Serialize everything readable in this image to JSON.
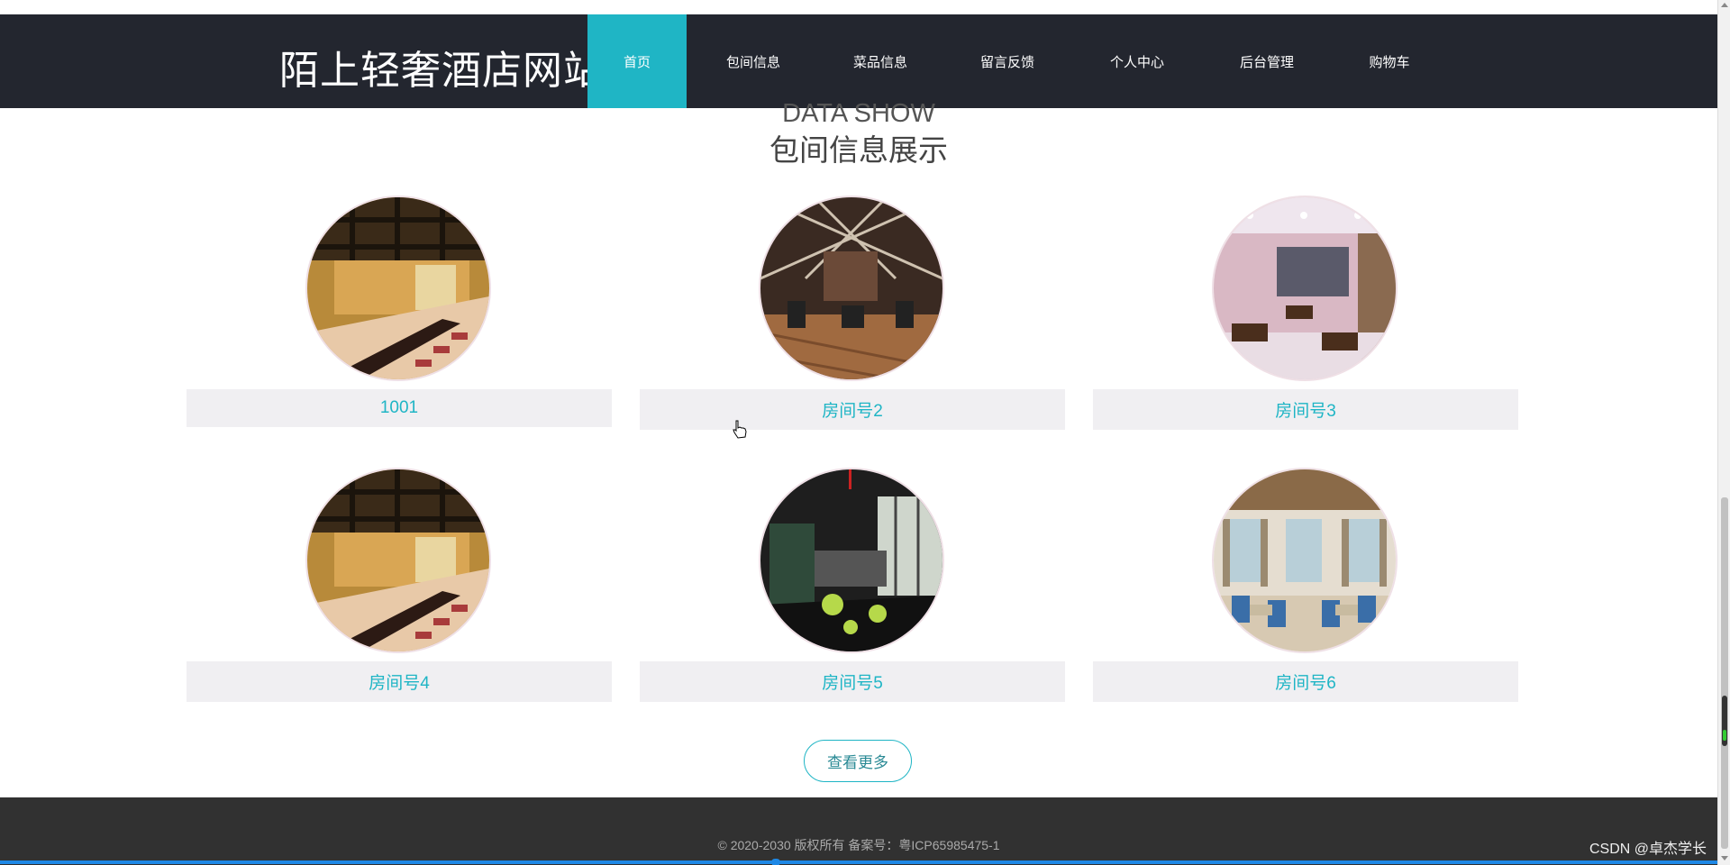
{
  "header": {
    "site_title": "陌上轻奢酒店网站",
    "nav": [
      {
        "label": "首页",
        "active": true
      },
      {
        "label": "包间信息",
        "active": false
      },
      {
        "label": "菜品信息",
        "active": false
      },
      {
        "label": "留言反馈",
        "active": false
      },
      {
        "label": "个人中心",
        "active": false
      },
      {
        "label": "后台管理",
        "active": false
      },
      {
        "label": "购物车",
        "active": false
      }
    ]
  },
  "section": {
    "title_en": "DATA SHOW",
    "title_zh": "包间信息展示"
  },
  "rooms": [
    {
      "label": "1001",
      "image": "japanese-tatami-room"
    },
    {
      "label": "房间号2",
      "image": "restaurant-hall-wood"
    },
    {
      "label": "房间号3",
      "image": "dining-room-screen"
    },
    {
      "label": "房间号4",
      "image": "japanese-tatami-room"
    },
    {
      "label": "房间号5",
      "image": "dark-dining-room"
    },
    {
      "label": "房间号6",
      "image": "blue-chair-dining-room"
    }
  ],
  "more_button": "查看更多",
  "footer": {
    "copyright": "© 2020-2030 版权所有 备案号：粤ICP65985475-1"
  },
  "watermark": "CSDN @卓杰学长",
  "colors": {
    "accent": "#1fb5c5",
    "header_bg": "#23262f",
    "footer_bg": "#313131",
    "label_bg": "#f0eff2"
  }
}
